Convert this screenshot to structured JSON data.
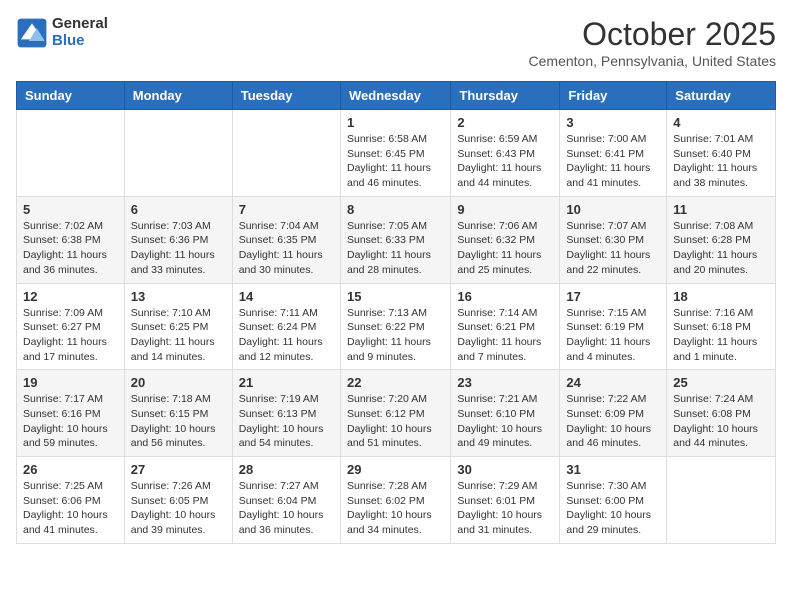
{
  "header": {
    "logo_general": "General",
    "logo_blue": "Blue",
    "month_title": "October 2025",
    "location": "Cementon, Pennsylvania, United States"
  },
  "days_of_week": [
    "Sunday",
    "Monday",
    "Tuesday",
    "Wednesday",
    "Thursday",
    "Friday",
    "Saturday"
  ],
  "weeks": [
    [
      {
        "day": "",
        "info": ""
      },
      {
        "day": "",
        "info": ""
      },
      {
        "day": "",
        "info": ""
      },
      {
        "day": "1",
        "info": "Sunrise: 6:58 AM\nSunset: 6:45 PM\nDaylight: 11 hours and 46 minutes."
      },
      {
        "day": "2",
        "info": "Sunrise: 6:59 AM\nSunset: 6:43 PM\nDaylight: 11 hours and 44 minutes."
      },
      {
        "day": "3",
        "info": "Sunrise: 7:00 AM\nSunset: 6:41 PM\nDaylight: 11 hours and 41 minutes."
      },
      {
        "day": "4",
        "info": "Sunrise: 7:01 AM\nSunset: 6:40 PM\nDaylight: 11 hours and 38 minutes."
      }
    ],
    [
      {
        "day": "5",
        "info": "Sunrise: 7:02 AM\nSunset: 6:38 PM\nDaylight: 11 hours and 36 minutes."
      },
      {
        "day": "6",
        "info": "Sunrise: 7:03 AM\nSunset: 6:36 PM\nDaylight: 11 hours and 33 minutes."
      },
      {
        "day": "7",
        "info": "Sunrise: 7:04 AM\nSunset: 6:35 PM\nDaylight: 11 hours and 30 minutes."
      },
      {
        "day": "8",
        "info": "Sunrise: 7:05 AM\nSunset: 6:33 PM\nDaylight: 11 hours and 28 minutes."
      },
      {
        "day": "9",
        "info": "Sunrise: 7:06 AM\nSunset: 6:32 PM\nDaylight: 11 hours and 25 minutes."
      },
      {
        "day": "10",
        "info": "Sunrise: 7:07 AM\nSunset: 6:30 PM\nDaylight: 11 hours and 22 minutes."
      },
      {
        "day": "11",
        "info": "Sunrise: 7:08 AM\nSunset: 6:28 PM\nDaylight: 11 hours and 20 minutes."
      }
    ],
    [
      {
        "day": "12",
        "info": "Sunrise: 7:09 AM\nSunset: 6:27 PM\nDaylight: 11 hours and 17 minutes."
      },
      {
        "day": "13",
        "info": "Sunrise: 7:10 AM\nSunset: 6:25 PM\nDaylight: 11 hours and 14 minutes."
      },
      {
        "day": "14",
        "info": "Sunrise: 7:11 AM\nSunset: 6:24 PM\nDaylight: 11 hours and 12 minutes."
      },
      {
        "day": "15",
        "info": "Sunrise: 7:13 AM\nSunset: 6:22 PM\nDaylight: 11 hours and 9 minutes."
      },
      {
        "day": "16",
        "info": "Sunrise: 7:14 AM\nSunset: 6:21 PM\nDaylight: 11 hours and 7 minutes."
      },
      {
        "day": "17",
        "info": "Sunrise: 7:15 AM\nSunset: 6:19 PM\nDaylight: 11 hours and 4 minutes."
      },
      {
        "day": "18",
        "info": "Sunrise: 7:16 AM\nSunset: 6:18 PM\nDaylight: 11 hours and 1 minute."
      }
    ],
    [
      {
        "day": "19",
        "info": "Sunrise: 7:17 AM\nSunset: 6:16 PM\nDaylight: 10 hours and 59 minutes."
      },
      {
        "day": "20",
        "info": "Sunrise: 7:18 AM\nSunset: 6:15 PM\nDaylight: 10 hours and 56 minutes."
      },
      {
        "day": "21",
        "info": "Sunrise: 7:19 AM\nSunset: 6:13 PM\nDaylight: 10 hours and 54 minutes."
      },
      {
        "day": "22",
        "info": "Sunrise: 7:20 AM\nSunset: 6:12 PM\nDaylight: 10 hours and 51 minutes."
      },
      {
        "day": "23",
        "info": "Sunrise: 7:21 AM\nSunset: 6:10 PM\nDaylight: 10 hours and 49 minutes."
      },
      {
        "day": "24",
        "info": "Sunrise: 7:22 AM\nSunset: 6:09 PM\nDaylight: 10 hours and 46 minutes."
      },
      {
        "day": "25",
        "info": "Sunrise: 7:24 AM\nSunset: 6:08 PM\nDaylight: 10 hours and 44 minutes."
      }
    ],
    [
      {
        "day": "26",
        "info": "Sunrise: 7:25 AM\nSunset: 6:06 PM\nDaylight: 10 hours and 41 minutes."
      },
      {
        "day": "27",
        "info": "Sunrise: 7:26 AM\nSunset: 6:05 PM\nDaylight: 10 hours and 39 minutes."
      },
      {
        "day": "28",
        "info": "Sunrise: 7:27 AM\nSunset: 6:04 PM\nDaylight: 10 hours and 36 minutes."
      },
      {
        "day": "29",
        "info": "Sunrise: 7:28 AM\nSunset: 6:02 PM\nDaylight: 10 hours and 34 minutes."
      },
      {
        "day": "30",
        "info": "Sunrise: 7:29 AM\nSunset: 6:01 PM\nDaylight: 10 hours and 31 minutes."
      },
      {
        "day": "31",
        "info": "Sunrise: 7:30 AM\nSunset: 6:00 PM\nDaylight: 10 hours and 29 minutes."
      },
      {
        "day": "",
        "info": ""
      }
    ]
  ]
}
